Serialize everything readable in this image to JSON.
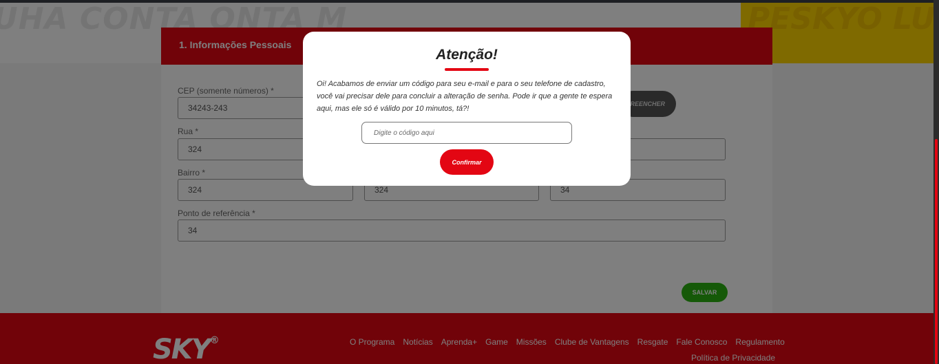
{
  "hero": {
    "left_text": "UHA CONTA ONTA M",
    "right_text": "PESKYO LUBE EV"
  },
  "form": {
    "step_title": "1. Informações Pessoais",
    "cep_label": "CEP (somente números) *",
    "cep_value": "34243-243",
    "fill_button": "PREENCHER",
    "rua_label": "Rua *",
    "rua_value": "324",
    "bairro_label": "Bairro *",
    "bairro_value": "324",
    "field2_value": "324",
    "field3_value": "34",
    "ref_label": "Ponto de referência *",
    "ref_value": "34",
    "save_button": "SALVAR"
  },
  "modal": {
    "title": "Atenção!",
    "message": "Oi! Acabamos de enviar um código para seu e-mail e para o seu telefone de cadastro, você vai precisar dele para concluir a alteração de senha. Pode ir que a gente te espera aqui, mas ele só é válido por 10 minutos, tá?!",
    "code_placeholder": "Digite o código aqui",
    "confirm_button": "Confirmar"
  },
  "footer": {
    "logo": "SKY",
    "logo_mark": "®",
    "links": [
      "O Programa",
      "Notícias",
      "Aprenda+",
      "Game",
      "Missões",
      "Clube de Vantagens",
      "Resgate",
      "Fale Conosco",
      "Regulamento"
    ],
    "privacy": "Política de Privacidade"
  },
  "colors": {
    "brand_red": "#e30613",
    "save_green": "#2bb310",
    "hero_yellow": "#ffd400"
  }
}
